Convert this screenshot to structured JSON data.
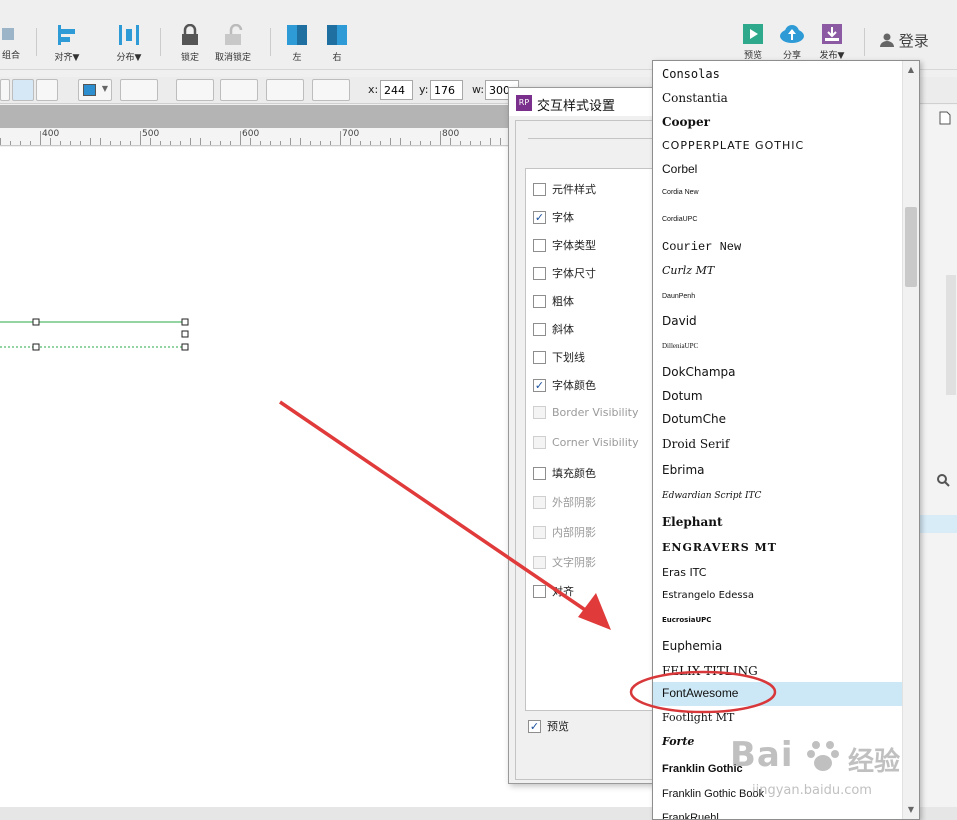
{
  "toolbar": {
    "ungroup_label": "组合",
    "align_label": "对齐▼",
    "distribute_label": "分布▼",
    "lock_label": "锁定",
    "unlock_label": "取消锁定",
    "left_label": "左",
    "right_label": "右",
    "preview_label": "预览",
    "share_label": "分享",
    "publish_label": "发布▼",
    "login_label": "登录",
    "accent_color": "#2e9bd6",
    "preview_color": "#2fa98c",
    "publish_color": "#8b5aa3"
  },
  "formatbar": {
    "x_label": "x:",
    "x_value": "244",
    "y_label": "y:",
    "y_value": "176",
    "w_label": "w:",
    "w_value": "300",
    "fill_color": "#2e8fd0"
  },
  "ruler": {
    "marks": [
      "400",
      "500",
      "600",
      "700",
      "800"
    ]
  },
  "dialog": {
    "title": "交互样式设置",
    "badge": "RP",
    "options": [
      {
        "label": "元件样式",
        "checked": false,
        "enabled": true
      },
      {
        "label": "字体",
        "checked": true,
        "enabled": true
      },
      {
        "label": "字体类型",
        "checked": false,
        "enabled": true
      },
      {
        "label": "字体尺寸",
        "checked": false,
        "enabled": true
      },
      {
        "label": "粗体",
        "checked": false,
        "enabled": true
      },
      {
        "label": "斜体",
        "checked": false,
        "enabled": true
      },
      {
        "label": "下划线",
        "checked": false,
        "enabled": true
      },
      {
        "label": "字体颜色",
        "checked": true,
        "enabled": true
      },
      {
        "label": "Border Visibility",
        "checked": false,
        "enabled": false
      },
      {
        "label": "Corner Visibility",
        "checked": false,
        "enabled": false
      },
      {
        "label": "填充颜色",
        "checked": false,
        "enabled": true
      },
      {
        "label": "外部阴影",
        "checked": false,
        "enabled": false
      },
      {
        "label": "内部阴影",
        "checked": false,
        "enabled": false
      },
      {
        "label": "文字阴影",
        "checked": false,
        "enabled": false
      },
      {
        "label": "对齐",
        "checked": false,
        "enabled": true
      }
    ],
    "preview_label": "预览",
    "preview_checked": true
  },
  "font_list": {
    "selected": "FontAwesome",
    "items": [
      "Consolas",
      "Constantia",
      "Cooper",
      "COPPERPLATE GOTHIC",
      "Corbel",
      "Cordia New",
      "CordiaUPC",
      "Courier New",
      "Curlz MT",
      "DaunPenh",
      "David",
      "DilleniaUPC",
      "DokChampa",
      "Dotum",
      "DotumChe",
      "Droid Serif",
      "Ebrima",
      "Edwardian Script ITC",
      "Elephant",
      "ENGRAVERS MT",
      "Eras ITC",
      "Estrangelo Edessa",
      "EucrosiaUPC",
      "Euphemia",
      "FELIX TITLING",
      "FontAwesome",
      "Footlight MT",
      "Forte",
      "Franklin Gothic",
      "Franklin Gothic Book",
      "FrankRuehl"
    ]
  },
  "annotation": {
    "arrow_color": "#e03a3a",
    "circle_color": "#d8383a"
  },
  "watermark": {
    "brand": "Bai",
    "tag": "经验",
    "url": "jingyan.baidu.com"
  }
}
